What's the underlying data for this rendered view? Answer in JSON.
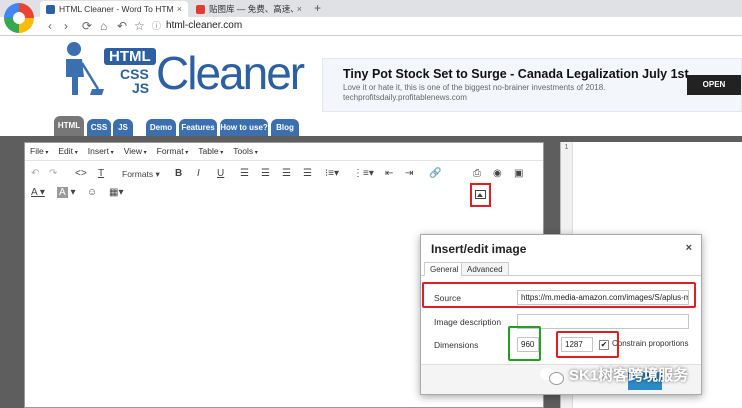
{
  "browser": {
    "active_tab_title": "HTML Cleaner - Word To HTML",
    "inactive_tab_title": "贴图库 — 免费、高速、稳定、好用",
    "url": "html-cleaner.com",
    "nav": {
      "back": "‹",
      "forward": "›",
      "reload": "⟳",
      "home": "⌂",
      "undo": "↶",
      "star": "☆"
    }
  },
  "site": {
    "logo": {
      "html": "HTML",
      "css": "CSS",
      "js": "JS",
      "cleaner": "Cleaner"
    },
    "ad": {
      "title": "Tiny Pot Stock Set to Surge - Canada Legalization July 1st",
      "desc": "Love it or hate it, this is one of the biggest no-brainer investments of 2018.",
      "domain": "techprofitsdaily.profitablenews.com",
      "open_label": "OPEN"
    },
    "tabs": [
      "HTML",
      "CSS",
      "JS",
      "Demo",
      "Features",
      "How to use?",
      "Blog"
    ]
  },
  "editor": {
    "menu": [
      "File",
      "Edit",
      "Insert",
      "View",
      "Format",
      "Table",
      "Tools"
    ],
    "formats_label": "Formats"
  },
  "preview": {
    "line_number": "1"
  },
  "dialog": {
    "title": "Insert/edit image",
    "close": "×",
    "tab_general": "General",
    "tab_advanced": "Advanced",
    "source_label": "Source",
    "source_value": "https://m.media-amazon.com/images/S/aplus-media/",
    "description_label": "Image description",
    "description_value": "",
    "dimensions_label": "Dimensions",
    "width_value": "960",
    "height_value": "1287",
    "x_sep": "x",
    "constrain_checked": "✔",
    "constrain_label": "Constrain proportions"
  },
  "watermark": {
    "text": "SK1树客跨境服务"
  },
  "colors": {
    "highlight_red": "#e02020",
    "highlight_green": "#22a020",
    "brand_blue": "#2d5fa3"
  }
}
